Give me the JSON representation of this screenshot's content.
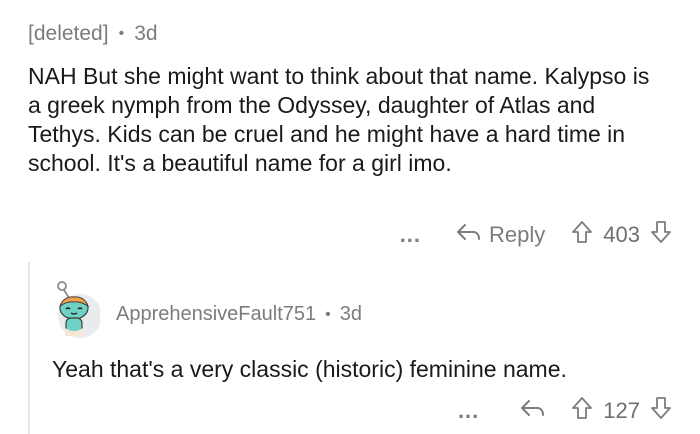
{
  "comment": {
    "author": "[deleted]",
    "age": "3d",
    "text": "NAH But she might want to think about that name. Kalypso is a greek nymph from the Odyssey, daughter of Atlas and Tethys. Kids can be cruel and he might have a hard time in school. It's a beautiful name for a girl imo.",
    "more_label": "...",
    "reply_label": "Reply",
    "votes": "403"
  },
  "reply": {
    "author": "ApprehensiveFault751",
    "age": "3d",
    "text": "Yeah that's a very classic (historic) feminine name.",
    "more_label": "...",
    "votes": "127"
  },
  "meta_separator": "•",
  "colors": {
    "muted": "#7c7c7c",
    "text": "#1a1a1b",
    "avatar_teal": "#6fd2c5",
    "avatar_bg": "#e9ecef"
  }
}
